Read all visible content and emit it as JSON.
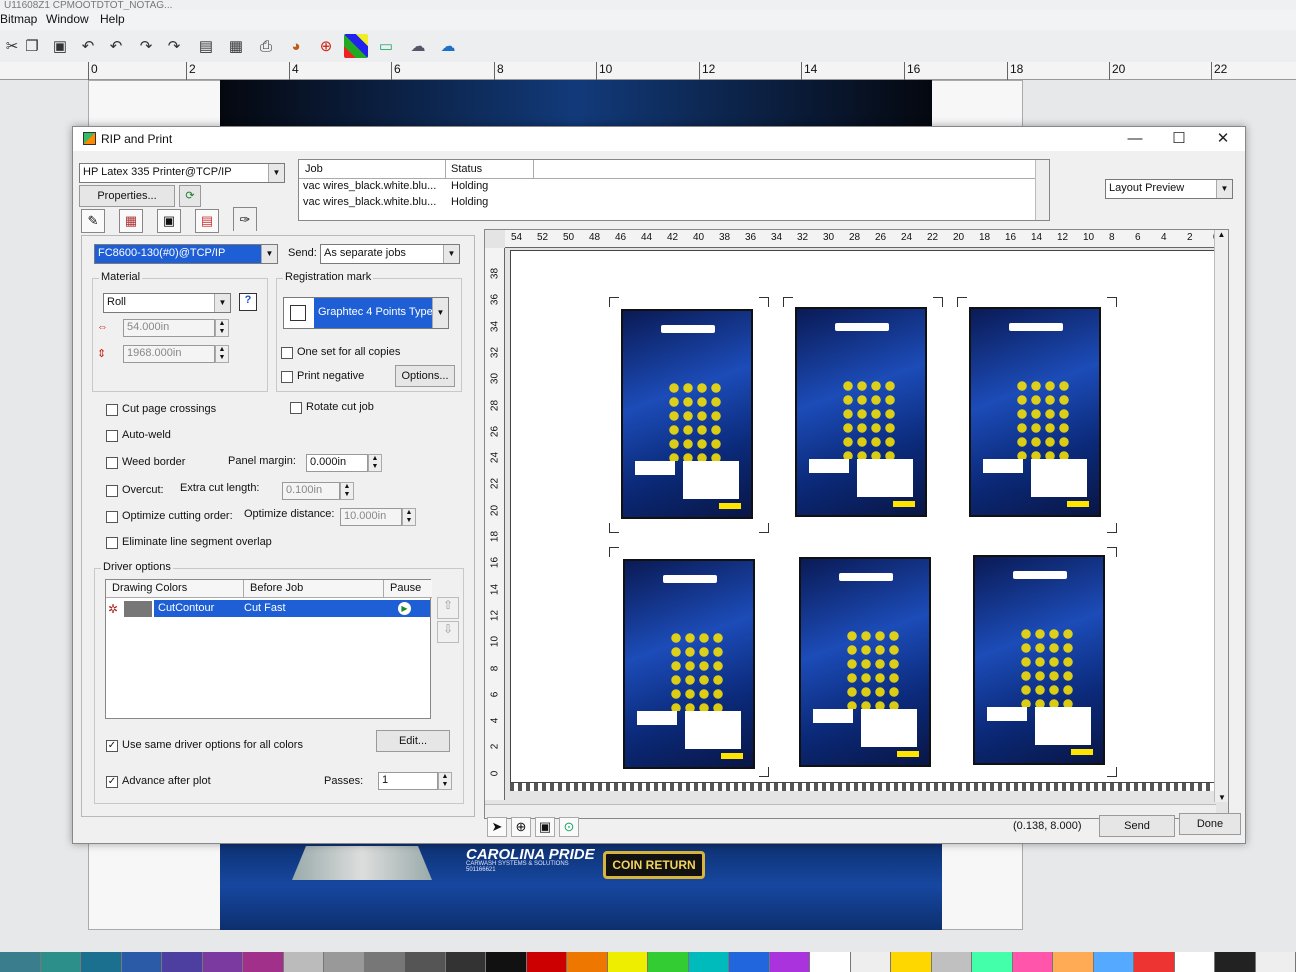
{
  "app": {
    "title_fragment": "U11608Z1 CPMOOTDTOT_NOTAG...",
    "menu": [
      "Bitmap",
      "Window",
      "Help"
    ],
    "ruler_ticks": [
      "0",
      "2",
      "4",
      "6",
      "8",
      "10",
      "12",
      "14",
      "16",
      "18",
      "20",
      "22"
    ],
    "footer_art": {
      "brand": "CAROLINA PRIDE",
      "brand_sub": "CARWASH SYSTEMS & SOLUTIONS",
      "code": "501166621",
      "coin_button": "COIN RETURN"
    }
  },
  "dialog": {
    "title": "RIP and Print",
    "window_controls": {
      "minimize": "—",
      "maximize": "☐",
      "close": "✕"
    },
    "printer": "HP Latex 335 Printer@TCP/IP",
    "properties_label": "Properties...",
    "jobs": {
      "headers": [
        "Job",
        "Status"
      ],
      "rows": [
        {
          "job": "vac wires_black.white.blu...",
          "status": "Holding"
        },
        {
          "job": "vac wires_black.white.blu...",
          "status": "Holding"
        }
      ]
    },
    "view_mode": "Layout Preview",
    "cutter": "FC8600-130(#0)@TCP/IP",
    "send_label": "Send:",
    "send_mode": "As separate jobs",
    "material": {
      "title": "Material",
      "type": "Roll",
      "width": "54.000in",
      "length": "1968.000in"
    },
    "registration": {
      "title": "Registration mark",
      "type": "Graphtec 4 Points Type",
      "one_set_label": "One set for all copies",
      "print_negative_label": "Print negative",
      "options_label": "Options..."
    },
    "options": {
      "cut_page_crossings": "Cut page crossings",
      "rotate_cut_job": "Rotate cut job",
      "auto_weld": "Auto-weld",
      "weed_border": "Weed border",
      "panel_margin_label": "Panel margin:",
      "panel_margin": "0.000in",
      "overcut": "Overcut:",
      "extra_cut_length_label": "Extra cut length:",
      "extra_cut_length": "0.100in",
      "optimize_order": "Optimize cutting order:",
      "optimize_distance_label": "Optimize distance:",
      "optimize_distance": "10.000in",
      "eliminate_overlap": "Eliminate line segment overlap"
    },
    "driver_options": {
      "title": "Driver options",
      "headers": [
        "Drawing Colors",
        "Before Job",
        "Pause"
      ],
      "row": {
        "color": "CutContour",
        "before_job": "Cut Fast"
      },
      "same_options_label": "Use same driver options for all colors",
      "edit_label": "Edit..."
    },
    "advance_after_plot": "Advance after plot",
    "passes_label": "Passes:",
    "passes": "1",
    "preview": {
      "h_ticks": [
        "54",
        "52",
        "50",
        "48",
        "46",
        "44",
        "42",
        "40",
        "38",
        "36",
        "34",
        "32",
        "30",
        "28",
        "26",
        "24",
        "22",
        "20",
        "18",
        "16",
        "14",
        "12",
        "10",
        "8",
        "6",
        "4",
        "2",
        "0"
      ],
      "v_ticks": [
        "38",
        "36",
        "34",
        "32",
        "30",
        "28",
        "26",
        "24",
        "22",
        "20",
        "18",
        "16",
        "14",
        "12",
        "10",
        "8",
        "6",
        "4",
        "2",
        "0"
      ],
      "copies": 6
    },
    "coords": "(0.138, 8.000)",
    "send_button": "Send",
    "done_button": "Done"
  }
}
